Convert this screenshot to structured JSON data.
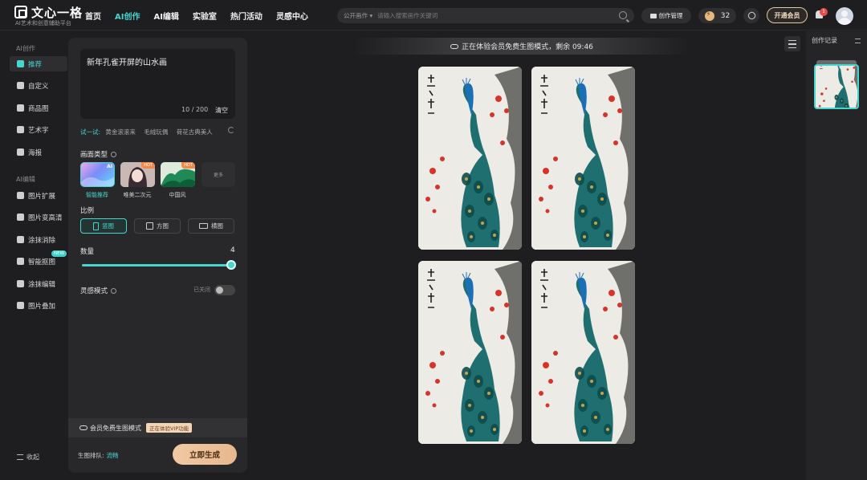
{
  "app": {
    "title": "文心一格",
    "subtitle": "AI艺术和创意辅助平台"
  },
  "nav": {
    "items": [
      "首页",
      "AI创作",
      "AI编辑",
      "实验室",
      "热门活动",
      "灵感中心"
    ],
    "active": "AI创作"
  },
  "search": {
    "scope": "公开画作 ▾",
    "placeholder": "请输入搜索画作关键词"
  },
  "header": {
    "manage_label": "创作管理",
    "points": "32",
    "vip_label": "开通会员",
    "notification_count": "1"
  },
  "sidebar": {
    "section_create": "AI创作",
    "create_items": [
      "推荐",
      "自定义",
      "商品图",
      "艺术字",
      "海报"
    ],
    "active": "推荐",
    "section_edit": "AI编辑",
    "edit_items": [
      "图片扩展",
      "图片变高清",
      "涂抹消除",
      "智能抠图",
      "涂抹编辑",
      "图片叠加"
    ],
    "new_badge": "NEW",
    "collapse_label": "收起"
  },
  "panel": {
    "prompt": "新年孔雀开屏的山水画",
    "counter": "10 / 200",
    "clear_label": "清空",
    "try_label": "试一试:",
    "suggestions": [
      "黄金滚滚来",
      "毛绒玩偶",
      "荷花古典美人"
    ],
    "style_label": "画面类型",
    "styles": [
      {
        "label": "智能推荐",
        "tag": "AI"
      },
      {
        "label": "唯美二次元",
        "tag": "HOT"
      },
      {
        "label": "中国风",
        "tag": "HOT"
      }
    ],
    "more_label": "更多",
    "ratio_label": "比例",
    "ratios": [
      "竖图",
      "方图",
      "横图"
    ],
    "selected_ratio": "竖图",
    "quantity_label": "数量",
    "quantity_value": "4",
    "quantity_fraction": 1.0,
    "inspire_label": "灵感模式",
    "inspire_state": "已关闭",
    "vip_strip": "会员免费生图模式",
    "vip_tag": "正在体验VIP功能",
    "queue_label": "生图排队:",
    "queue_value": "流畅",
    "generate_label": "立即生成"
  },
  "main": {
    "banner": "正在体验会员免费生图模式，剩余 09:46",
    "image_count": 4
  },
  "right_panel": {
    "title": "创作记录"
  },
  "colors": {
    "accent": "#46d6d0",
    "background": "#1e1e20",
    "panel": "#28282a",
    "gold": "#e8b78e"
  }
}
